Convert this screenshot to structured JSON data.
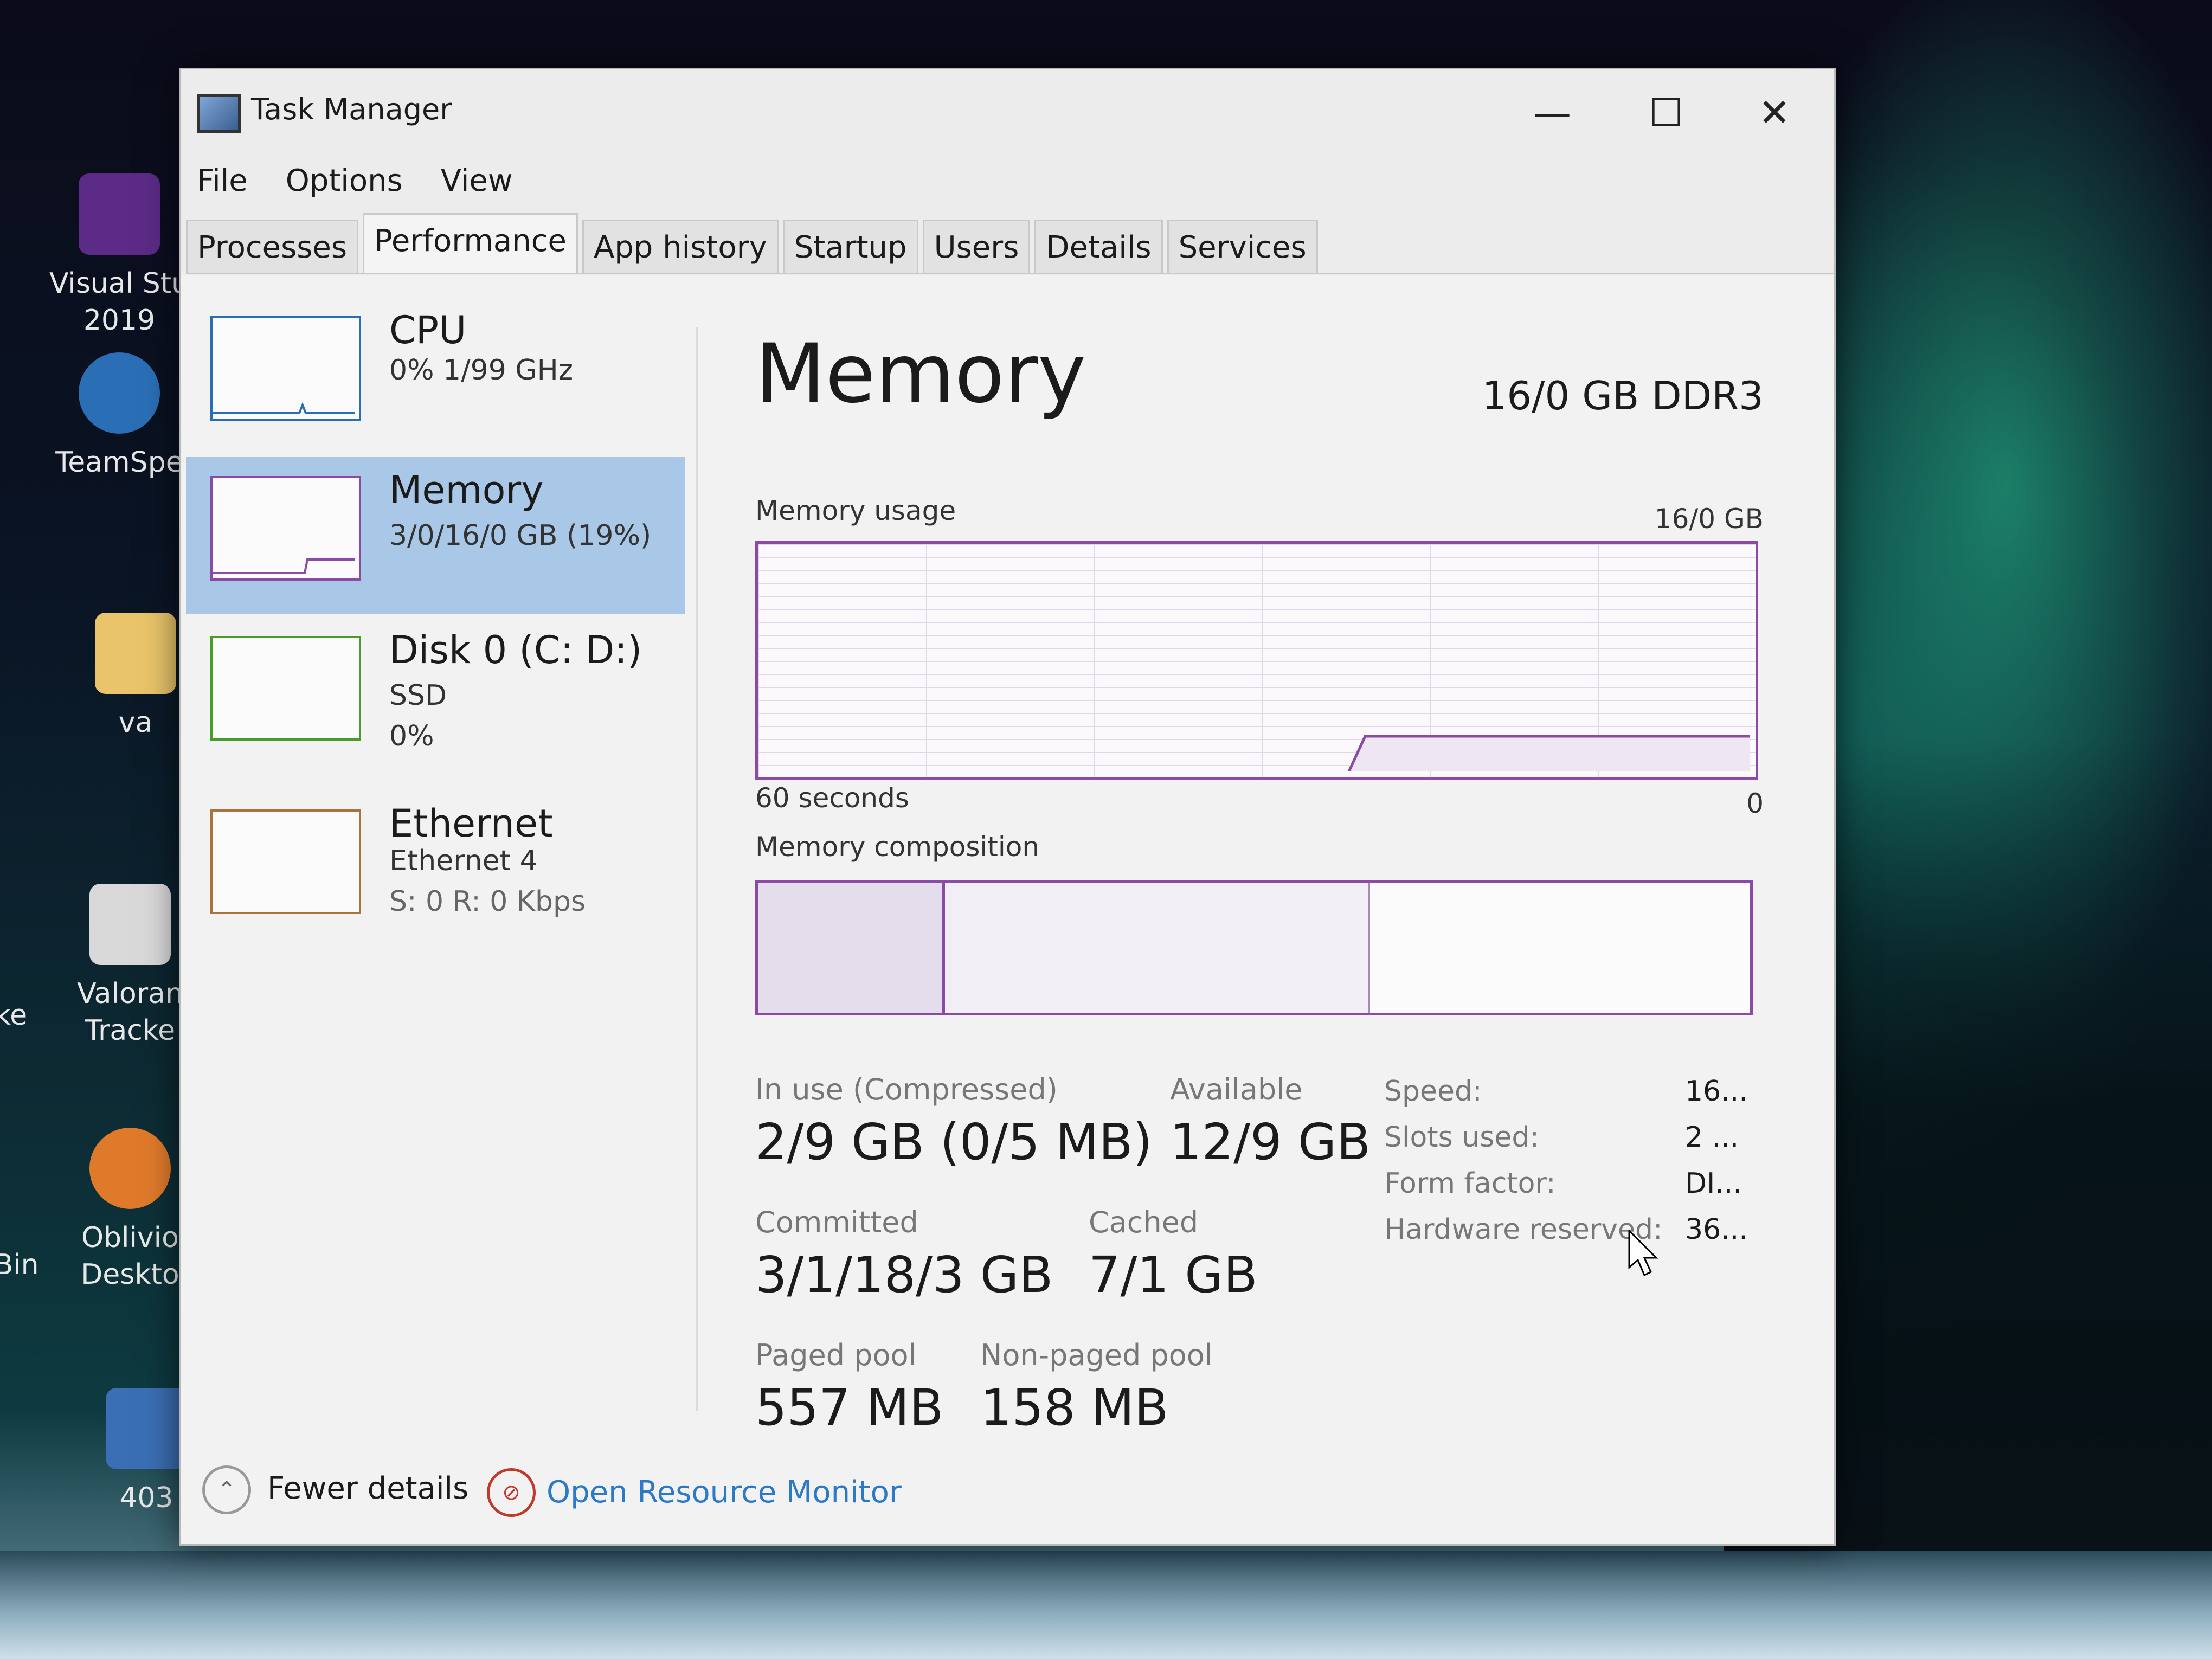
{
  "desktop": {
    "icons": [
      {
        "label": "Visual Stu\n2019"
      },
      {
        "label": "TeamSpe"
      },
      {
        "label": "va"
      },
      {
        "label": "Valoran\nTracke"
      },
      {
        "label": "Oblivio\nDeskto"
      },
      {
        "label": "403"
      }
    ],
    "edge_labels": [
      "ke",
      "Bin"
    ]
  },
  "window": {
    "title": "Task Manager",
    "minimize": "—",
    "maximize": "☐",
    "close": "✕"
  },
  "menu": [
    "File",
    "Options",
    "View"
  ],
  "tabs": [
    "Processes",
    "Performance",
    "App history",
    "Startup",
    "Users",
    "Details",
    "Services"
  ],
  "active_tab": "Performance",
  "sidebar": [
    {
      "title": "CPU",
      "line1": "0% 1/99 GHz"
    },
    {
      "title": "Memory",
      "line1": "3/0/16/0 GB (19%)"
    },
    {
      "title": "Disk 0 (C: D:)",
      "line1": "SSD",
      "line2": "0%"
    },
    {
      "title": "Ethernet",
      "line1": "Ethernet 4",
      "line2": "S: 0 R: 0 Kbps"
    }
  ],
  "memory": {
    "title": "Memory",
    "type": "16/0 GB DDR3",
    "usage_label": "Memory usage",
    "usage_max": "16/0 GB",
    "time_label": "60 seconds",
    "time_end": "0",
    "composition_label": "Memory composition",
    "stats": {
      "in_use_label": "In use (Compressed)",
      "in_use_value": "2/9 GB (0/5 MB)",
      "available_label": "Available",
      "available_value": "12/9 GB",
      "committed_label": "Committed",
      "committed_value": "3/1/18/3 GB",
      "cached_label": "Cached",
      "cached_value": "7/1 GB",
      "paged_label": "Paged pool",
      "paged_value": "557 MB",
      "nonpaged_label": "Non-paged pool",
      "nonpaged_value": "158 MB"
    },
    "specs": [
      {
        "label": "Speed:",
        "value": "16..."
      },
      {
        "label": "Slots used:",
        "value": "2 ..."
      },
      {
        "label": "Form factor:",
        "value": "DI..."
      },
      {
        "label": "Hardware reserved:",
        "value": "36..."
      }
    ]
  },
  "footer": {
    "fewer_details": "Fewer details",
    "open_resource_monitor": "Open Resource Monitor"
  },
  "colors": {
    "memory_accent": "#8b4aa6",
    "cpu_accent": "#2a6fb5",
    "disk_accent": "#4c9a2a",
    "ethernet_accent": "#a8743c",
    "selection": "#a9c7e6",
    "link": "#2b79c7"
  }
}
